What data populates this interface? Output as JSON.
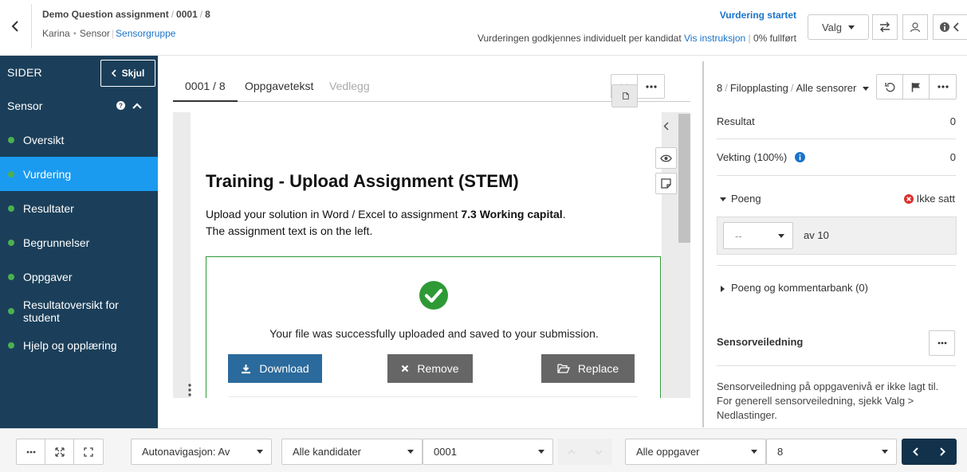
{
  "header": {
    "assignment": "Demo Question assignment",
    "candidate": "0001",
    "question": "8",
    "user": "Karina",
    "role": "Sensor",
    "group_link": "Sensorgruppe",
    "status": "Vurdering startet",
    "note": "Vurderingen godkjennes individuelt per kandidat",
    "instructions_link": "Vis instruksjon",
    "progress": "0% fullført",
    "valg_label": "Valg"
  },
  "sidebar": {
    "title": "SIDER",
    "hide_label": "Skjul",
    "section": "Sensor",
    "items": [
      {
        "label": "Oversikt",
        "active": false
      },
      {
        "label": "Vurdering",
        "active": true
      },
      {
        "label": "Resultater",
        "active": false
      },
      {
        "label": "Begrunnelser",
        "active": false
      },
      {
        "label": "Oppgaver",
        "active": false
      },
      {
        "label": "Resultatoversikt for student",
        "active": false
      },
      {
        "label": "Hjelp og opplæring",
        "active": false
      }
    ]
  },
  "tabs": [
    {
      "label": "0001 / 8",
      "state": "active"
    },
    {
      "label": "Oppgavetekst",
      "state": "normal"
    },
    {
      "label": "Vedlegg",
      "state": "disabled"
    }
  ],
  "document": {
    "title": "Training - Upload Assignment (STEM)",
    "line1_pre": "Upload your solution in Word / Excel to assignment ",
    "line1_bold": "7.3 Working capital",
    "line1_post": ".",
    "line2": "The assignment text is on the left.",
    "upload_message": "Your file was successfully uploaded and saved to your submission.",
    "download_label": "Download",
    "remove_label": "Remove",
    "replace_label": "Replace"
  },
  "panel": {
    "question_no": "8",
    "question_type": "Filopplasting",
    "sensor_filter": "Alle sensorer",
    "resultat_label": "Resultat",
    "resultat_value": "0",
    "vekting_label": "Vekting (100%)",
    "vekting_value": "0",
    "poeng_label": "Poeng",
    "poeng_status": "Ikke satt",
    "poeng_select": "--",
    "poeng_max": "av 10",
    "bank_label": "Poeng og kommentarbank (0)",
    "guidance_title": "Sensorveiledning",
    "guidance_text": "Sensorveiledning på oppgavenivå er ikke lagt til. For generell sensorveiledning, sjekk Valg > Nedlastinger."
  },
  "footer": {
    "autonav": "Autonavigasjon: Av",
    "candidates": "Alle kandidater",
    "candidate": "0001",
    "tasks": "Alle oppgaver",
    "task": "8"
  },
  "colors": {
    "sidebar_bg": "#1b3f5a",
    "active_item": "#1a9bf0",
    "link": "#1a73c9",
    "download_btn": "#2b6a9c",
    "grey_btn": "#666666",
    "success": "#2e9a36",
    "pager_bg": "#12324b"
  }
}
